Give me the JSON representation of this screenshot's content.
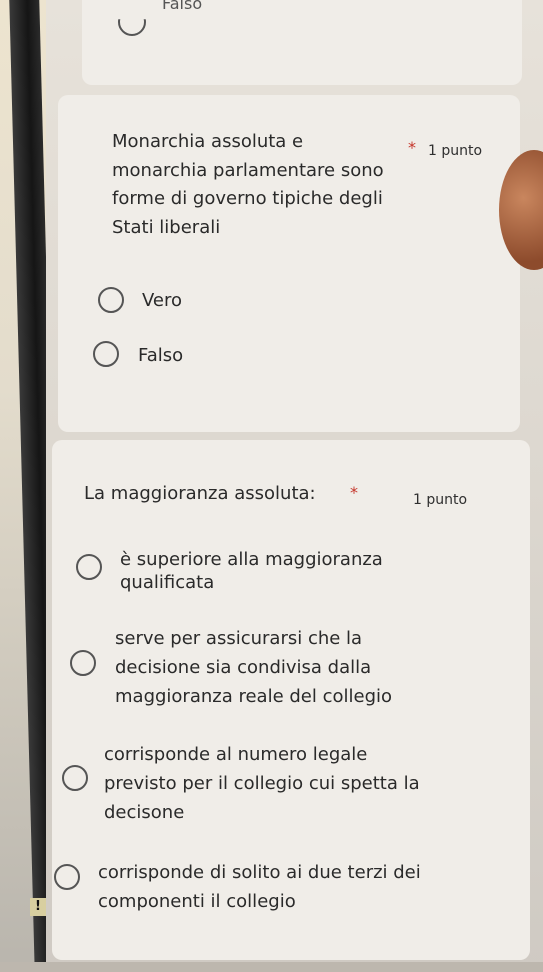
{
  "previous_question": {
    "visible_option": "Falso"
  },
  "questions": [
    {
      "text": "Monarchia assoluta e\nmonarchia parlamentare sono\nforme di governo tipiche degli\nStati liberali",
      "required": "*",
      "points": "1 punto",
      "options": [
        "Vero",
        "Falso"
      ]
    },
    {
      "text": "La maggioranza assoluta:",
      "required": "*",
      "points": "1 punto",
      "options": [
        "è superiore alla maggioranza\nqualificata",
        "serve per assicurarsi che la\ndecisione sia condivisa dalla\nmaggioranza reale del collegio",
        "corrisponde al numero legale\nprevisto per il collegio cui spetta la\ndecisone",
        "corrisponde di solito ai due terzi dei\ncomponenti il collegio"
      ]
    }
  ],
  "alert_icon": "!"
}
